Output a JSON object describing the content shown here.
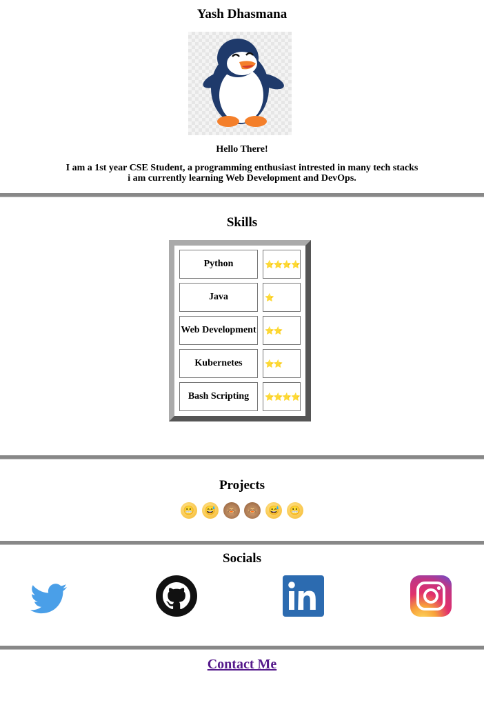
{
  "profile": {
    "name": "Yash Dhasmana",
    "greeting": "Hello There!",
    "bio_line1": "I am a 1st year CSE Student, a programming enthusiast intrested in many tech stacks",
    "bio_line2": "i am currently learning Web Development and DevOps."
  },
  "skills": {
    "title": "Skills",
    "items": [
      {
        "name": "Python",
        "rating": 4,
        "stars": "⭐⭐⭐⭐"
      },
      {
        "name": "Java",
        "rating": 1,
        "stars": "⭐"
      },
      {
        "name": "Web Development",
        "rating": 2,
        "stars": "⭐⭐"
      },
      {
        "name": "Kubernetes",
        "rating": 2,
        "stars": "⭐⭐"
      },
      {
        "name": "Bash Scripting",
        "rating": 4,
        "stars": "⭐⭐⭐⭐"
      }
    ]
  },
  "projects": {
    "title": "Projects",
    "emojis": [
      "😬",
      "😅",
      "🙈",
      "🙈",
      "😅",
      "😬"
    ]
  },
  "socials": {
    "title": "Socials",
    "icons": [
      "twitter-icon",
      "github-icon",
      "linkedin-icon",
      "instagram-icon"
    ]
  },
  "contact": {
    "label": "Contact Me"
  },
  "colors": {
    "twitter": "#4a9fe8",
    "linkedin": "#2c6bb0",
    "link": "#551a8b",
    "divider": "#888888"
  }
}
